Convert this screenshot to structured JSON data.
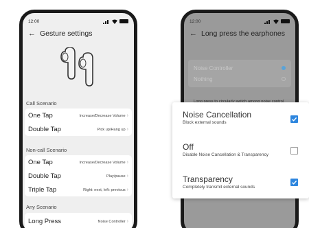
{
  "left": {
    "time": "12:00",
    "title": "Gesture settings",
    "sections": [
      {
        "label": "Call Scenario",
        "rows": [
          {
            "name": "One Tap",
            "value": "Increase/Decrease Volume"
          },
          {
            "name": "Double Tap",
            "value": "Pick up/Hang up"
          }
        ]
      },
      {
        "label": "Non-call Scenario",
        "rows": [
          {
            "name": "One Tap",
            "value": "Increase/Decrease Volume"
          },
          {
            "name": "Double Tap",
            "value": "Play/pause"
          },
          {
            "name": "Triple Tap",
            "value": "Right: next, left: previous"
          }
        ]
      },
      {
        "label": "Any Scenario",
        "rows": [
          {
            "name": "Long Press",
            "value": "Noise Controller"
          }
        ]
      }
    ]
  },
  "right": {
    "time": "12:00",
    "title": "Long press the earphones",
    "options": [
      {
        "label": "Noise Controller",
        "selected": true
      },
      {
        "label": "Nothing",
        "selected": false
      }
    ],
    "hint": "Long press to circularly switch among noise control modes"
  },
  "popup": {
    "options": [
      {
        "title": "Noise Cancellation",
        "subtitle": "Block external sounds",
        "checked": true
      },
      {
        "title": "Off",
        "subtitle": "Disable Noise Cancellation & Transparency",
        "checked": false
      },
      {
        "title": "Transparency",
        "subtitle": "Completely transmit external sounds",
        "checked": true
      }
    ]
  },
  "colors": {
    "accent": "#2e86de",
    "radio_accent": "#5aa3d8",
    "left_bg": "#efefef",
    "right_bg": "#9a9a9a"
  },
  "icons": {
    "back": "back-arrow-icon",
    "signal": "signal-icon",
    "wifi": "wifi-icon",
    "battery": "battery-icon",
    "chevron": "chevron-right-icon",
    "earbuds": "earbuds-illustration"
  }
}
